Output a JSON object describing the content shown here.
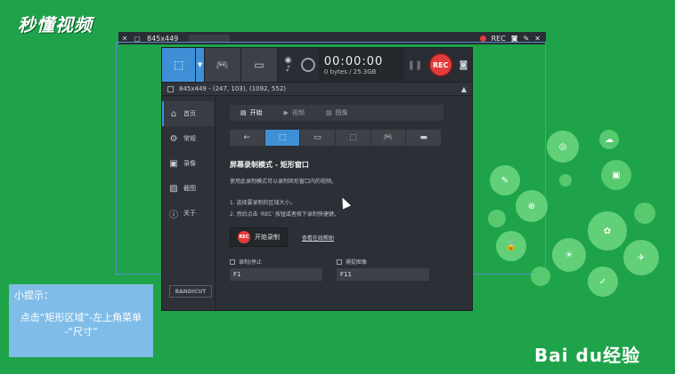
{
  "watermark": {
    "logo_text": "秒懂视频",
    "baidu_text": "Bai du经验"
  },
  "topbar": {
    "size": "845x449",
    "rec_label": "REC"
  },
  "toolbar": {
    "timer": "00:00:00",
    "bytes": "0 bytes / 25.3GB",
    "rec_label": "REC"
  },
  "subbar": {
    "text": "845x449 - (247, 103), (1092, 552)"
  },
  "sidebar": {
    "items": [
      {
        "label": "首页"
      },
      {
        "label": "常规"
      },
      {
        "label": "录像"
      },
      {
        "label": "截图"
      },
      {
        "label": "关于"
      }
    ],
    "brand": "BANDICUT"
  },
  "tabs": [
    {
      "label": "开始"
    },
    {
      "label": "视频"
    },
    {
      "label": "图像"
    }
  ],
  "main": {
    "title": "屏幕录制模式 - 矩形窗口",
    "desc": "使用此录制模式可以录制矩形窗口内的视频。",
    "step1": "1. 选择要录制的区域大小。",
    "step2": "2. 然后点击 'REC' 按钮或者按下录制快捷键。",
    "start_button": "开始录制",
    "rec_badge": "REC",
    "help_link": "查看在线帮助"
  },
  "hotkeys": [
    {
      "label": "录制/停止",
      "value": "F1"
    },
    {
      "label": "捕捉图像",
      "value": "F11"
    }
  ],
  "tip": {
    "title": "小提示：",
    "line1": "点击“矩形区域”-左上角菜单",
    "line2": "-“尺寸”"
  }
}
